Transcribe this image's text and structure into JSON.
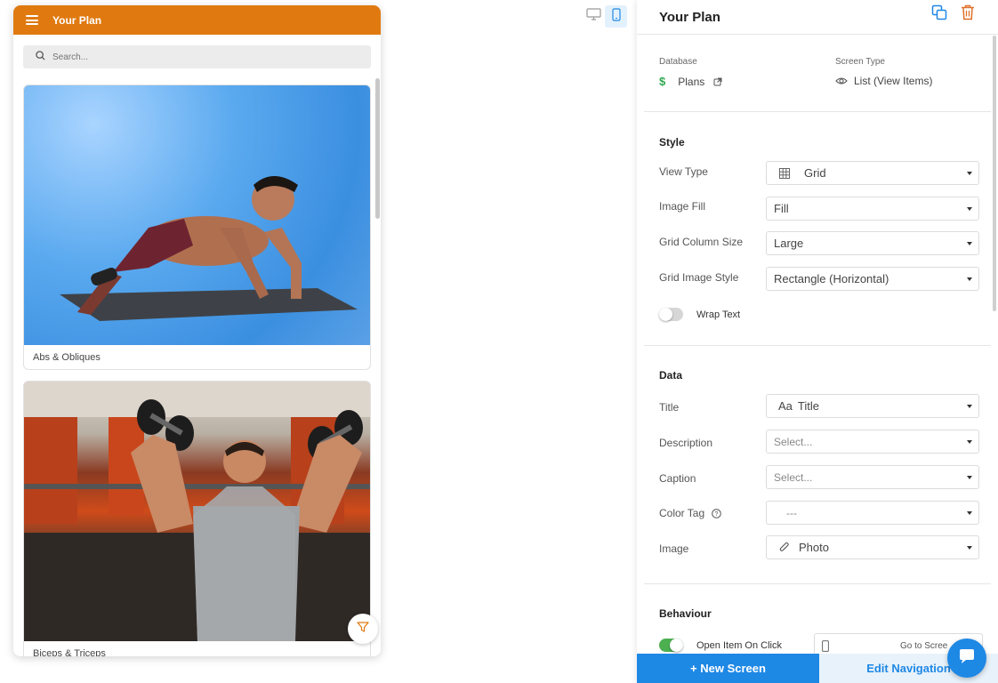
{
  "preview": {
    "header_title": "Your Plan",
    "search_placeholder": "Search...",
    "cards": [
      {
        "caption": "Abs & Obliques"
      },
      {
        "caption": "Biceps & Triceps"
      }
    ]
  },
  "panel": {
    "title": "Your Plan",
    "database_label": "Database",
    "database_value": "Plans",
    "screen_type_label": "Screen Type",
    "screen_type_value": "List (View Items)",
    "style": {
      "section_title": "Style",
      "view_type_label": "View Type",
      "view_type_value": "Grid",
      "image_fill_label": "Image Fill",
      "image_fill_value": "Fill",
      "grid_column_size_label": "Grid Column Size",
      "grid_column_size_value": "Large",
      "grid_image_style_label": "Grid Image Style",
      "grid_image_style_value": "Rectangle (Horizontal)",
      "wrap_text_label": "Wrap Text",
      "wrap_text_on": false
    },
    "data": {
      "section_title": "Data",
      "title_label": "Title",
      "title_prefix": "Aa",
      "title_value": "Title",
      "description_label": "Description",
      "description_value": "Select...",
      "caption_label": "Caption",
      "caption_value": "Select...",
      "color_tag_label": "Color Tag",
      "color_tag_value": "---",
      "image_label": "Image",
      "image_value": "Photo"
    },
    "behaviour": {
      "section_title": "Behaviour",
      "open_item_label": "Open Item On Click",
      "open_item_on": true,
      "goto_value": "Go to Scree"
    }
  },
  "footer": {
    "new_screen": "+  New Screen",
    "edit_navigation": "Edit Navigation"
  },
  "colors": {
    "header_orange": "#e07a10",
    "accent_blue": "#1e88e5",
    "delete_orange": "#e0702a",
    "dollar_green": "#2fa84f"
  }
}
